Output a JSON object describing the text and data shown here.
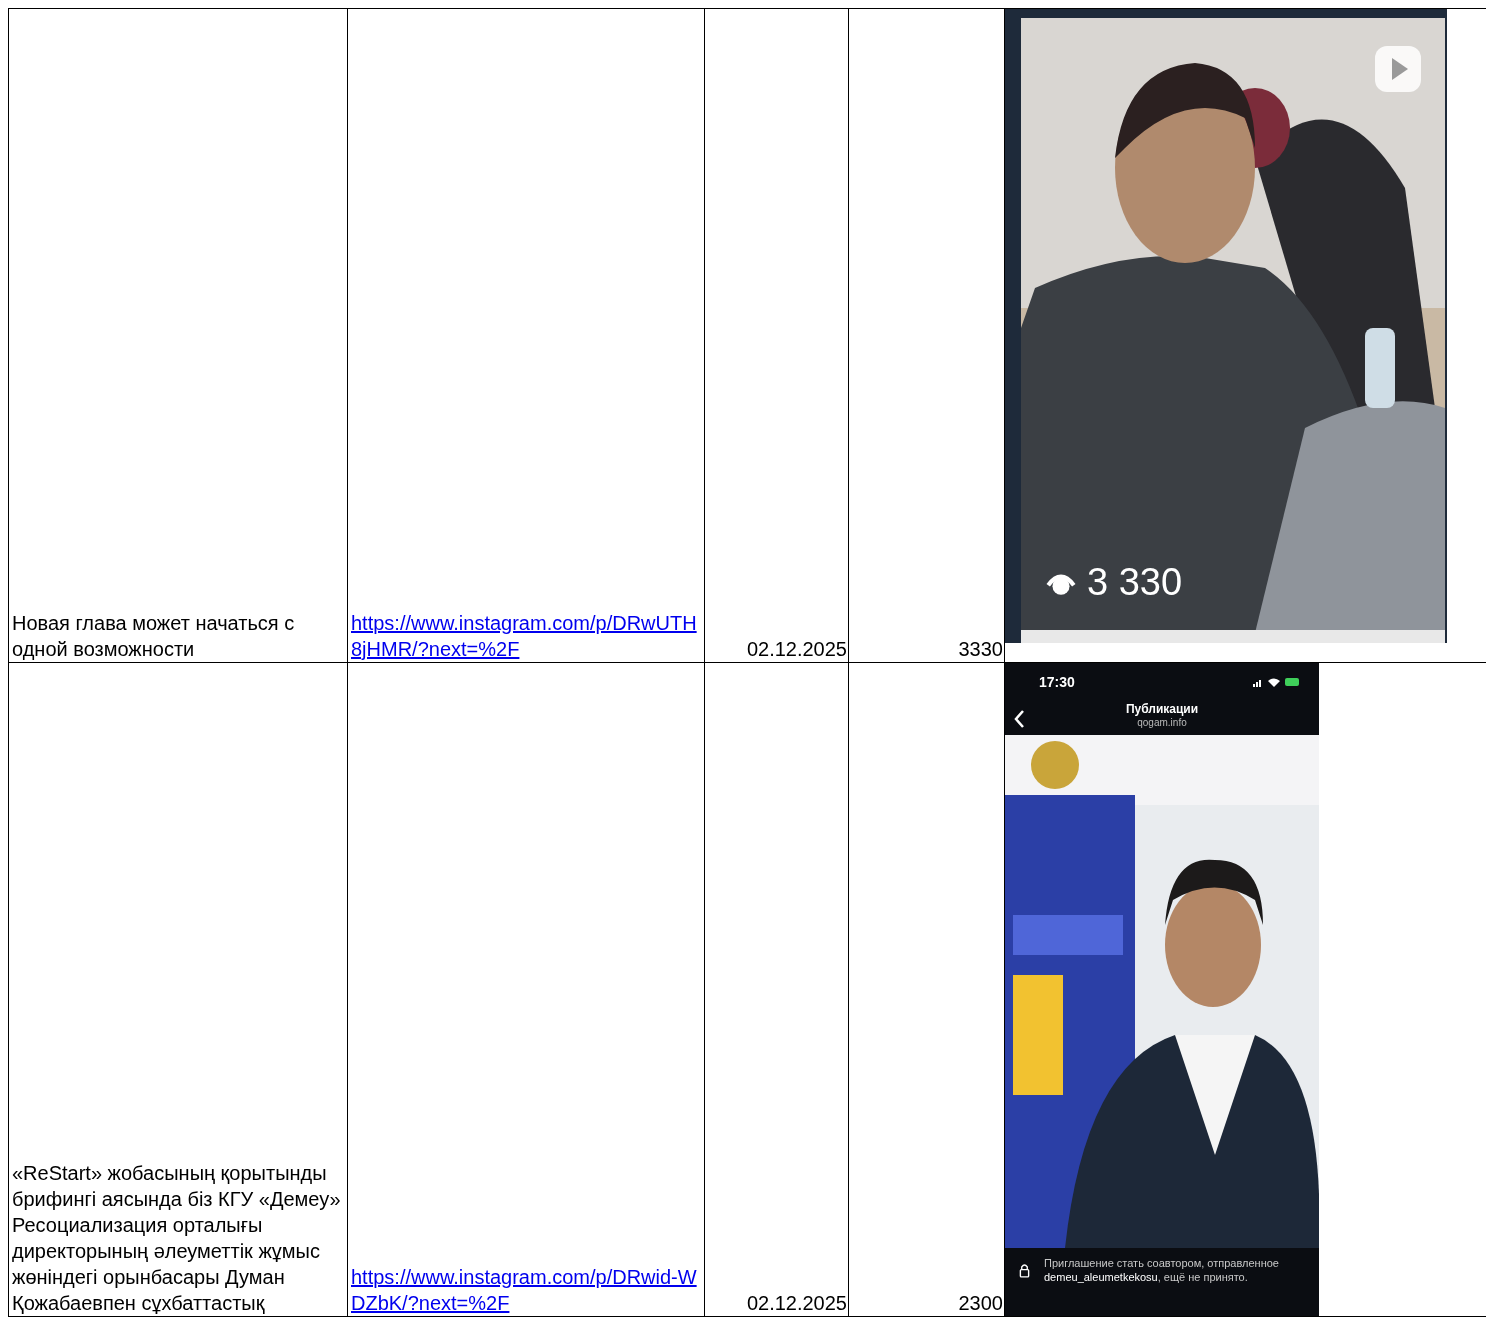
{
  "table": {
    "rows": [
      {
        "title": "Новая глава может начаться с одной возможности",
        "link": "https://www.instagram.com/p/DRwUTH8jHMR/?next=%2F",
        "date": "02.12.2025",
        "views": "3330",
        "media": {
          "kind": "reel",
          "view_count": "3 330"
        }
      },
      {
        "title": "«ReStart» жобасының қорытынды брифингі аясында біз КГУ «Демеу» Ресоциализация орталығы директорының әлеуметтік жұмыс жөніндегі орынбасары Думан Қожабаевпен сұхбаттастық",
        "link": "https://www.instagram.com/p/DRwid-WDZbK/?next=%2F",
        "date": "02.12.2025",
        "views": "2300",
        "media": {
          "kind": "phone",
          "time": "17:30",
          "header": "Публикации",
          "subheader": "qogam.info",
          "notice": "Приглашение стать соавтором, отправленное **demeu_aleumetkekosu**, ещё не принято."
        }
      }
    ]
  }
}
